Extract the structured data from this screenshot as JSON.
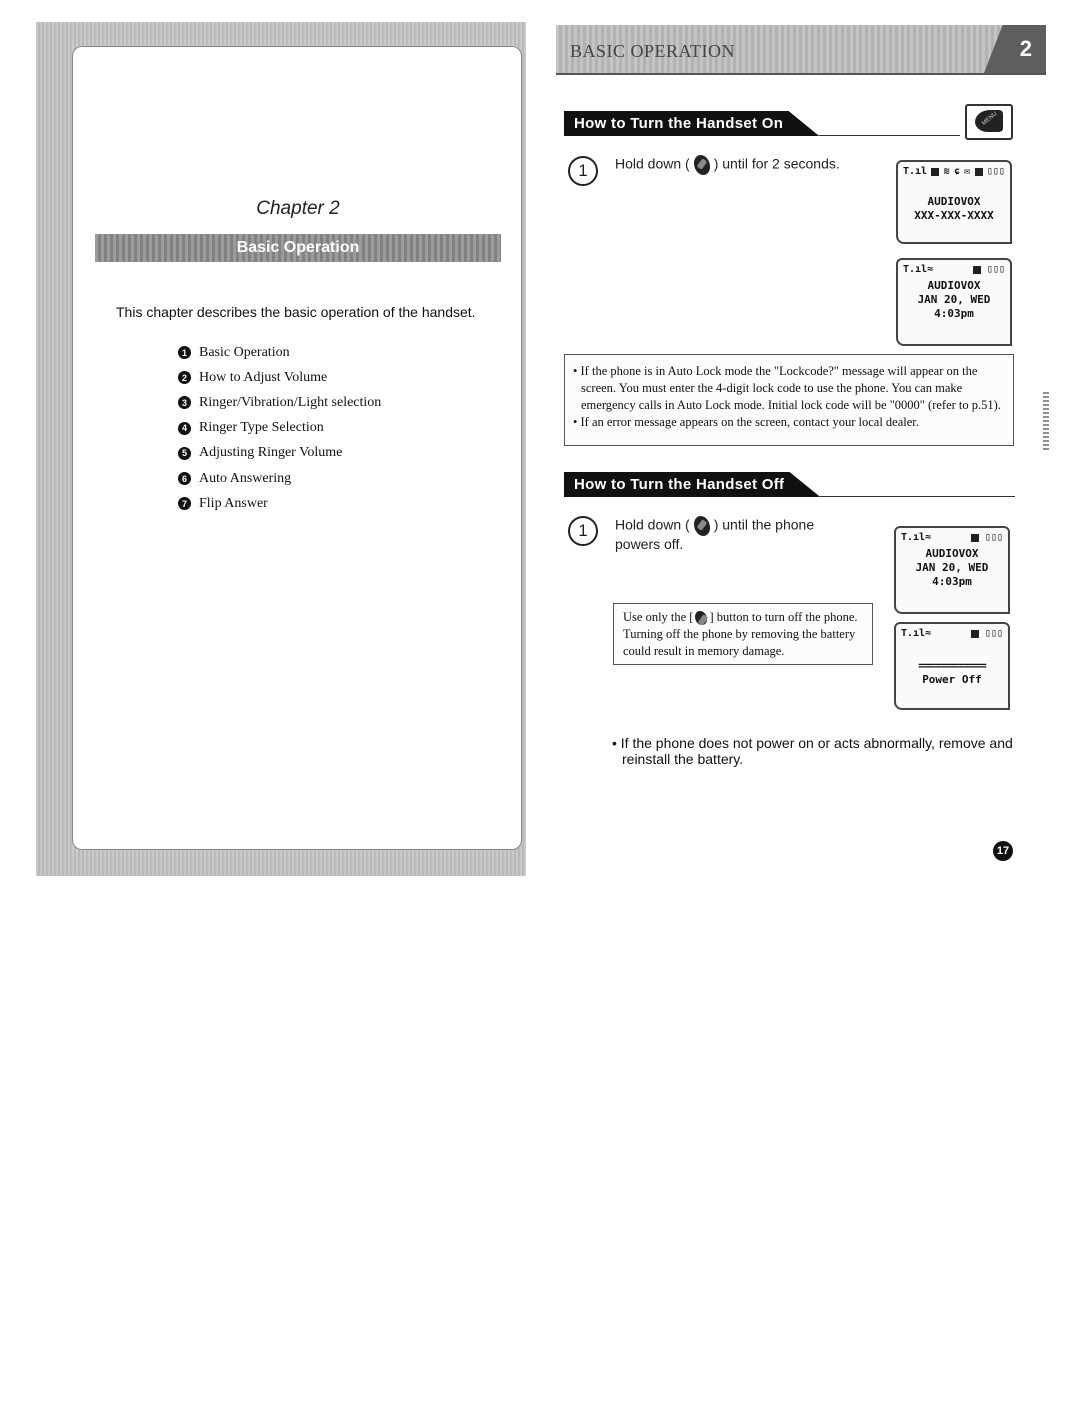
{
  "left_page": {
    "chapter_title": "Chapter 2",
    "banner": "Basic Operation",
    "description": "This chapter describes the basic operation of the handset.",
    "toc": [
      {
        "num": "1",
        "label": "Basic Operation"
      },
      {
        "num": "2",
        "label": "How to Adjust Volume"
      },
      {
        "num": "3",
        "label": "Ringer/Vibration/Light selection"
      },
      {
        "num": "4",
        "label": "Ringer Type Selection"
      },
      {
        "num": "5",
        "label": "Adjusting Ringer Volume"
      },
      {
        "num": "6",
        "label": "Auto Answering"
      },
      {
        "num": "7",
        "label": "Flip Answer"
      }
    ]
  },
  "right_page": {
    "header_title": "BASIC OPERATION",
    "chapter_tab": "2",
    "menu_key_label": "MENU",
    "section_on": {
      "heading": "How to Turn the Handset On",
      "step_num": "1",
      "step_before": "Hold down (",
      "step_after": ") until for 2 seconds.",
      "lcd1": {
        "status": [
          "signal-icon",
          "roaming-icon",
          "sms-icon",
          "voicemail-icon",
          "envelope-icon",
          "digital-icon",
          "battery-icon"
        ],
        "lines": [
          "AUDIOVOX",
          "XXX-XXX-XXXX"
        ]
      },
      "lcd2": {
        "status": [
          "signal-icon",
          "alert-icon",
          "digital-icon",
          "battery-icon"
        ],
        "lines": [
          "AUDIOVOX",
          "JAN 20, WED",
          "4:03pm"
        ]
      },
      "notes": [
        "If the phone is in Auto Lock mode the \"Lockcode?\" message will appear on the screen. You must enter the 4-digit lock code to use the phone. You can make emergency calls in Auto Lock mode. Initial lock code will be \"0000\" (refer to p.51).",
        "If an error message appears on the screen, contact your local dealer."
      ]
    },
    "section_off": {
      "heading": "How to Turn the Handset Off",
      "step_num": "1",
      "step_before": "Hold down (",
      "step_after": ") until the phone powers off.",
      "note_before": "Use only the [",
      "note_after": "] button to turn off the phone. Turning off the phone by removing the battery could result in memory damage.",
      "lcd1": {
        "lines": [
          "AUDIOVOX",
          "JAN 20, WED",
          "4:03pm"
        ]
      },
      "lcd2": {
        "lines": [
          "============",
          "Power Off"
        ]
      }
    },
    "tip": "• If the phone does not power on or acts abnormally, remove and reinstall the battery.",
    "page_number": "17"
  }
}
